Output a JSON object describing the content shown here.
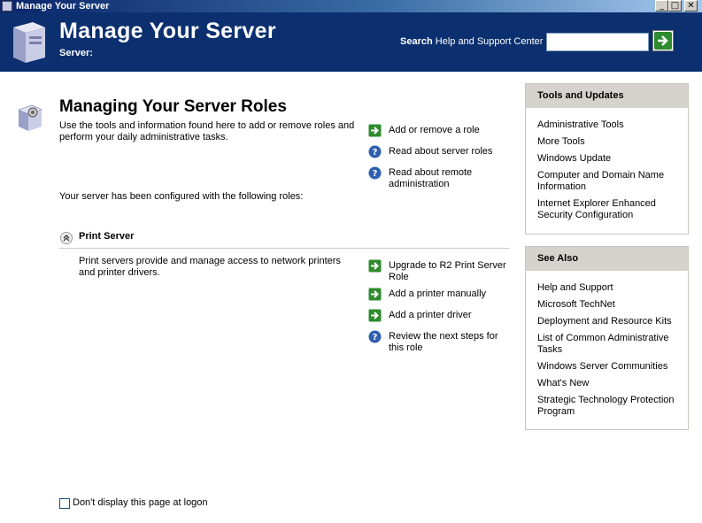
{
  "window": {
    "title": "Manage Your Server",
    "min": "_",
    "max": "□",
    "close": "✕"
  },
  "header": {
    "title": "Manage Your Server",
    "server_label": "Server:",
    "search_bold": "Search",
    "search_rest": " Help and Support Center",
    "search_value": ""
  },
  "main": {
    "heading": "Managing Your Server Roles",
    "description": "Use the tools and information found here to add or remove roles and perform your daily administrative tasks.",
    "configured_text": "Your server has been configured with the following roles:",
    "actions": [
      {
        "label": "Add or remove a role",
        "icon": "arrow-icon"
      },
      {
        "label": "Read about server roles",
        "icon": "help-icon"
      },
      {
        "label": "Read about remote administration",
        "icon": "help-icon"
      }
    ]
  },
  "role": {
    "title": "Print Server",
    "description": "Print servers provide and manage access to network printers and printer drivers.",
    "actions": [
      {
        "label": "Upgrade to R2 Print Server Role",
        "icon": "arrow-icon"
      },
      {
        "label": "Add a printer manually",
        "icon": "arrow-icon"
      },
      {
        "label": "Add a printer driver",
        "icon": "arrow-icon"
      },
      {
        "label": "Review the next steps for this role",
        "icon": "help-icon"
      }
    ]
  },
  "tools": {
    "title": "Tools and Updates",
    "items": [
      "Administrative Tools",
      "More Tools",
      "Windows Update",
      "Computer and Domain Name Information",
      "Internet Explorer Enhanced Security Configuration"
    ]
  },
  "see_also": {
    "title": "See Also",
    "items": [
      "Help and Support",
      "Microsoft TechNet",
      "Deployment and Resource Kits",
      "List of Common Administrative Tasks",
      "Windows Server Communities",
      "What's New",
      "Strategic Technology Protection Program"
    ]
  },
  "footer": {
    "checkbox_label": "Don't display this page at logon",
    "checked": false
  },
  "colors": {
    "header_bg": "#0b2f6f",
    "go_green": "#2e8b2e",
    "help_blue": "#2f5fb0"
  }
}
